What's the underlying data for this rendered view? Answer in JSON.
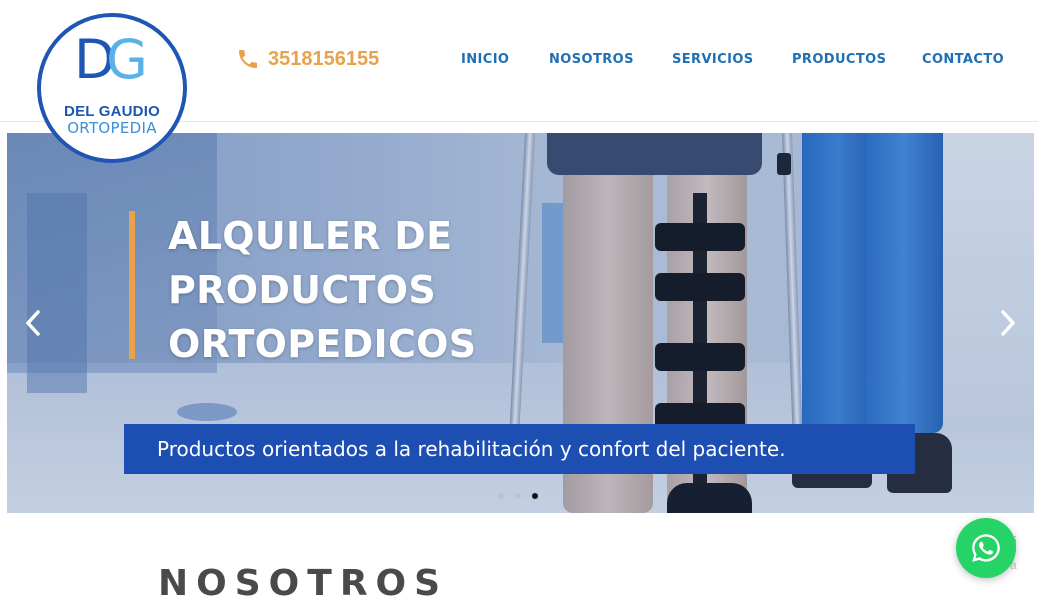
{
  "logo": {
    "mark_left": "D",
    "mark_right": "G",
    "name": "DEL GAUDIO",
    "subtitle": "ORTOPEDIA"
  },
  "contact": {
    "phone": "3518156155"
  },
  "nav": {
    "items": [
      {
        "label": "INICIO"
      },
      {
        "label": "NOSOTROS"
      },
      {
        "label": "SERVICIOS"
      },
      {
        "label": "PRODUCTOS"
      },
      {
        "label": "CONTACTO"
      }
    ]
  },
  "slider": {
    "title_lines": [
      "ALQUILER DE",
      "PRODUCTOS",
      "ORTOPEDICOS"
    ],
    "caption": "Productos orientados a la rehabilitación y confort del paciente.",
    "slide_count": 3,
    "active_slide": 3
  },
  "section": {
    "title": "NOSOTROS"
  },
  "chat": {
    "hint_line1": "cti",
    "hint_line2": "e a"
  },
  "colors": {
    "brand_blue": "#1f56b4",
    "accent_orange": "#e8a24a",
    "nav_blue": "#1f6fb5",
    "whatsapp_green": "#25d366"
  }
}
